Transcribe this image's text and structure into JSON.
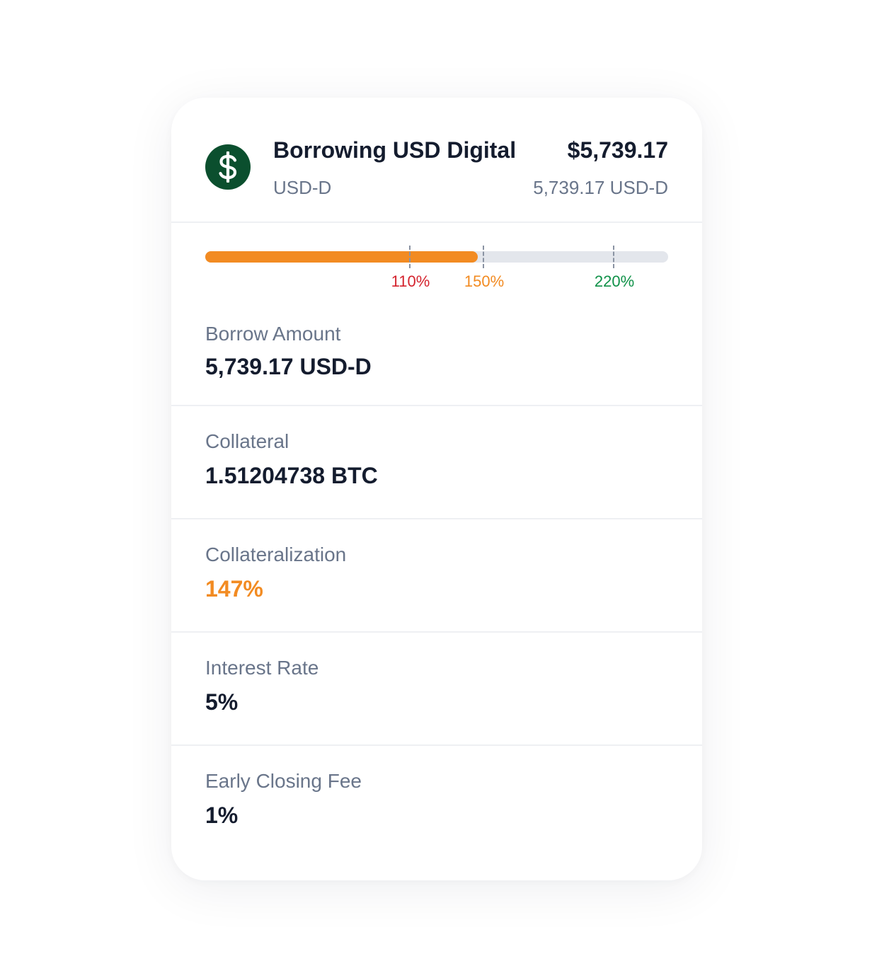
{
  "header": {
    "icon": "dollar-icon",
    "title": "Borrowing USD Digital",
    "symbol": "USD-D",
    "fiat_value": "$5,739.17",
    "token_value": "5,739.17 USD-D"
  },
  "collateral_bar": {
    "current_percent": 147,
    "scale_max_percent": 250,
    "markers": [
      {
        "label": "110%",
        "value": 110,
        "color": "#d4232e"
      },
      {
        "label": "150%",
        "value": 150,
        "color": "#f28b22"
      },
      {
        "label": "220%",
        "value": 220,
        "color": "#0f9148"
      }
    ]
  },
  "details": [
    {
      "label": "Borrow Amount",
      "value": "5,739.17 USD-D"
    },
    {
      "label": "Collateral",
      "value": "1.51204738 BTC"
    },
    {
      "label": "Collateralization",
      "value": "147%",
      "value_color": "#f28b22"
    },
    {
      "label": "Interest Rate",
      "value": "5%"
    },
    {
      "label": "Early Closing Fee",
      "value": "1%"
    }
  ],
  "colors": {
    "accent_orange": "#f28b22",
    "danger_red": "#d4232e",
    "safe_green": "#0f9148",
    "coin_green": "#0b4f2e"
  }
}
